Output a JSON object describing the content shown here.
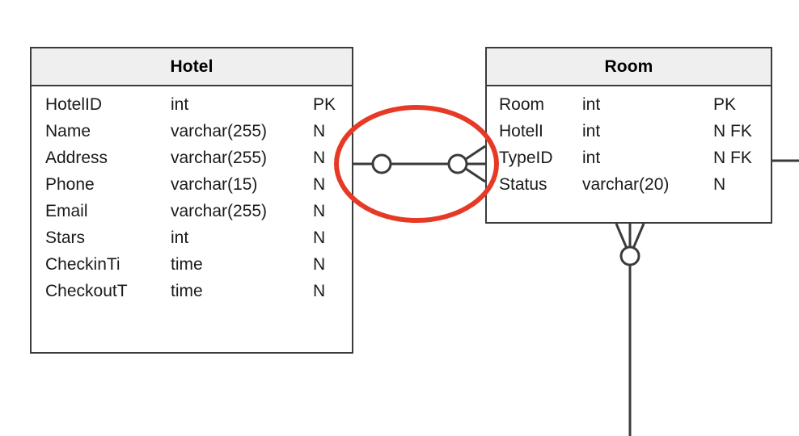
{
  "diagram": {
    "type": "entity-relationship-diagram",
    "background_color": "#ffffff",
    "line_color": "#3b3b3b",
    "header_fill": "#efefef",
    "highlight_color": "#e63a26"
  },
  "entities": [
    {
      "id": "hotel",
      "title": "Hotel",
      "attributes": [
        {
          "name": "HotelID",
          "type": "int",
          "key": "PK"
        },
        {
          "name": "Name",
          "type": "varchar(255)",
          "key": "N"
        },
        {
          "name": "Address",
          "type": "varchar(255)",
          "key": "N"
        },
        {
          "name": "Phone",
          "type": "varchar(15)",
          "key": "N"
        },
        {
          "name": "Email",
          "type": "varchar(255)",
          "key": "N"
        },
        {
          "name": "Stars",
          "type": "int",
          "key": "N"
        },
        {
          "name": "CheckinTi",
          "type": "time",
          "key": "N"
        },
        {
          "name": "CheckoutT",
          "type": "time",
          "key": "N"
        }
      ]
    },
    {
      "id": "room",
      "title": "Room",
      "attributes": [
        {
          "name": "Room",
          "type": "int",
          "key": "PK"
        },
        {
          "name": "HotelI",
          "type": "int",
          "key": "N FK"
        },
        {
          "name": "TypeID",
          "type": "int",
          "key": "N FK"
        },
        {
          "name": "Status",
          "type": "varchar(20)",
          "key": "N"
        }
      ]
    }
  ],
  "relationships": [
    {
      "id": "hotel-room",
      "from": "hotel",
      "to": "room",
      "from_cardinality": "zero-or-one",
      "to_cardinality": "zero-or-many",
      "notation": "crows-foot",
      "highlighted": true
    },
    {
      "id": "room-bottom",
      "from": "room",
      "to": "offscreen-below",
      "from_cardinality": "zero-or-many",
      "notation": "crows-foot",
      "highlighted": false
    },
    {
      "id": "room-right",
      "from": "room",
      "to": "offscreen-right",
      "notation": "line",
      "highlighted": false
    }
  ],
  "annotations": [
    {
      "id": "relationship-highlight",
      "shape": "ellipse",
      "color": "#e63a26",
      "stroke_width": 6,
      "target": "hotel-room"
    }
  ]
}
